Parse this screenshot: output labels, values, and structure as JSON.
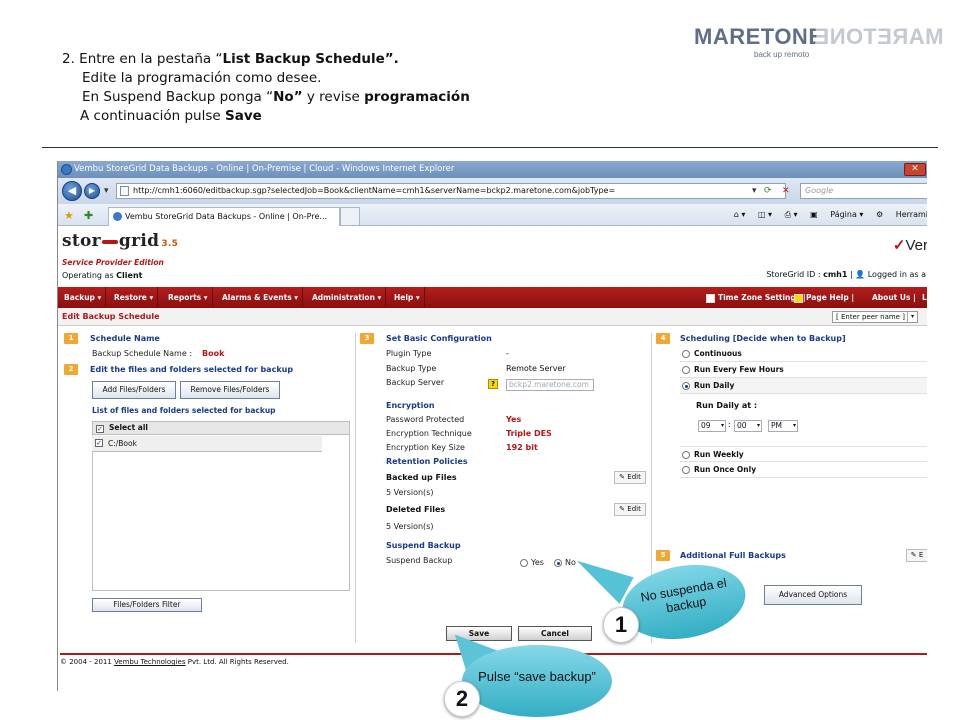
{
  "instructions": {
    "line1_prefix": "2. Entre en la pestaña “",
    "line1_bold": "List Backup Schedule”.",
    "line2": "Edite la programación como desee.",
    "line3_prefix": "En Suspend Backup ponga  “",
    "line3_bold": "No”",
    "line3_mid": " y revise ",
    "line3_bold2": "programación",
    "line4_prefix": "A continuación pulse ",
    "line4_bold": "Save"
  },
  "logo": {
    "name": "MARETONE",
    "mirror": "MARETONE",
    "tagline": "back up remoto"
  },
  "browser": {
    "window_title": "Vembu StoreGrid Data Backups - Online | On-Premise | Cloud - Windows Internet Explorer",
    "url": "http://cmh1:6060/editbackup.sgp?selectedJob=Book&clientName=cmh1&serverName=bckp2.maretone.com&jobType=",
    "search_placeholder": "Google",
    "tab_title": "Vembu StoreGrid Data Backups - Online | On-Pre...",
    "cmd_page": "Página",
    "cmd_tools": "Herrami"
  },
  "app": {
    "brand_a": "stor",
    "brand_b": "grid",
    "brand_version": "3.5",
    "edition": "Service Provider Edition",
    "operating_prefix": "Operating as ",
    "operating_role": "Client",
    "vendor": "Ver",
    "storegrid_id_prefix": "StoreGrid ID : ",
    "storegrid_id": "cmh1",
    "logged_in": "Logged in as a"
  },
  "menu": {
    "items": [
      "Backup ▾",
      "Restore ▾",
      "Reports ▾",
      "Alarms & Events ▾",
      "Administration ▾",
      "Help ▾"
    ],
    "right": [
      "Time Zone Settings",
      "Page Help",
      "About Us",
      "L"
    ]
  },
  "subheader": {
    "title": "Edit Backup Schedule",
    "peer_placeholder": "[ Enter peer name ]"
  },
  "schedule": {
    "num1": "1",
    "title": "Schedule Name",
    "name_label": "Backup Schedule Name :",
    "name_value": "Book",
    "num2": "2",
    "files_title": "Edit the files and folders selected for backup",
    "add_btn": "Add Files/Folders",
    "remove_btn": "Remove Files/Folders",
    "list_title": "List of files and folders selected for backup",
    "select_all": "Select all",
    "item": "C:/Book",
    "filter_btn": "Files/Folders Filter"
  },
  "config": {
    "num": "3",
    "title": "Set Basic Configuration",
    "plugin_label": "Plugin Type",
    "plugin_value": "-",
    "backup_type_label": "Backup Type",
    "backup_type_value": "Remote Server",
    "server_label": "Backup Server",
    "server_value": "bckp2.maretone.com",
    "encryption_title": "Encryption",
    "pw_label": "Password Protected",
    "pw_value": "Yes",
    "tech_label": "Encryption Technique",
    "tech_value": "Triple DES",
    "key_label": "Encryption Key Size",
    "key_value": "192 bit",
    "retention_title": "Retention Policies",
    "backed_label": "Backed up Files",
    "backed_value": "5  Version(s)",
    "deleted_label": "Deleted Files",
    "deleted_value": "5  Version(s)",
    "edit": "Edit",
    "suspend_title": "Suspend Backup",
    "suspend_label": "Suspend Backup",
    "yes": "Yes",
    "no": "No"
  },
  "scheduling": {
    "num": "4",
    "title": "Scheduling [Decide when to Backup]",
    "opt_continuous": "Continuous",
    "opt_few_hours": "Run Every Few Hours",
    "opt_daily": "Run Daily",
    "daily_at": "Run Daily at :",
    "hour": "09",
    "minute": "00",
    "ampm": "PM",
    "opt_weekly": "Run Weekly",
    "opt_once": "Run Once Only",
    "num5": "5",
    "additional": "Additional Full Backups",
    "edit": "E",
    "advanced": "Advanced Options"
  },
  "actions": {
    "save": "Save",
    "cancel": "Cancel"
  },
  "footer": {
    "prefix": "© 2004 - 2011 ",
    "link": "Vembu Technologies",
    "suffix": " Pvt. Ltd. All Rights Reserved."
  },
  "callouts": {
    "one_text": "No suspenda el backup",
    "one_num": "1",
    "two_text": "Pulse “save backup”",
    "two_num": "2"
  },
  "colors": {
    "brand_red": "#b11818",
    "section_blue": "#1a3a8a",
    "callout_cyan": "#33aec4",
    "step_orange": "#f0a830"
  }
}
